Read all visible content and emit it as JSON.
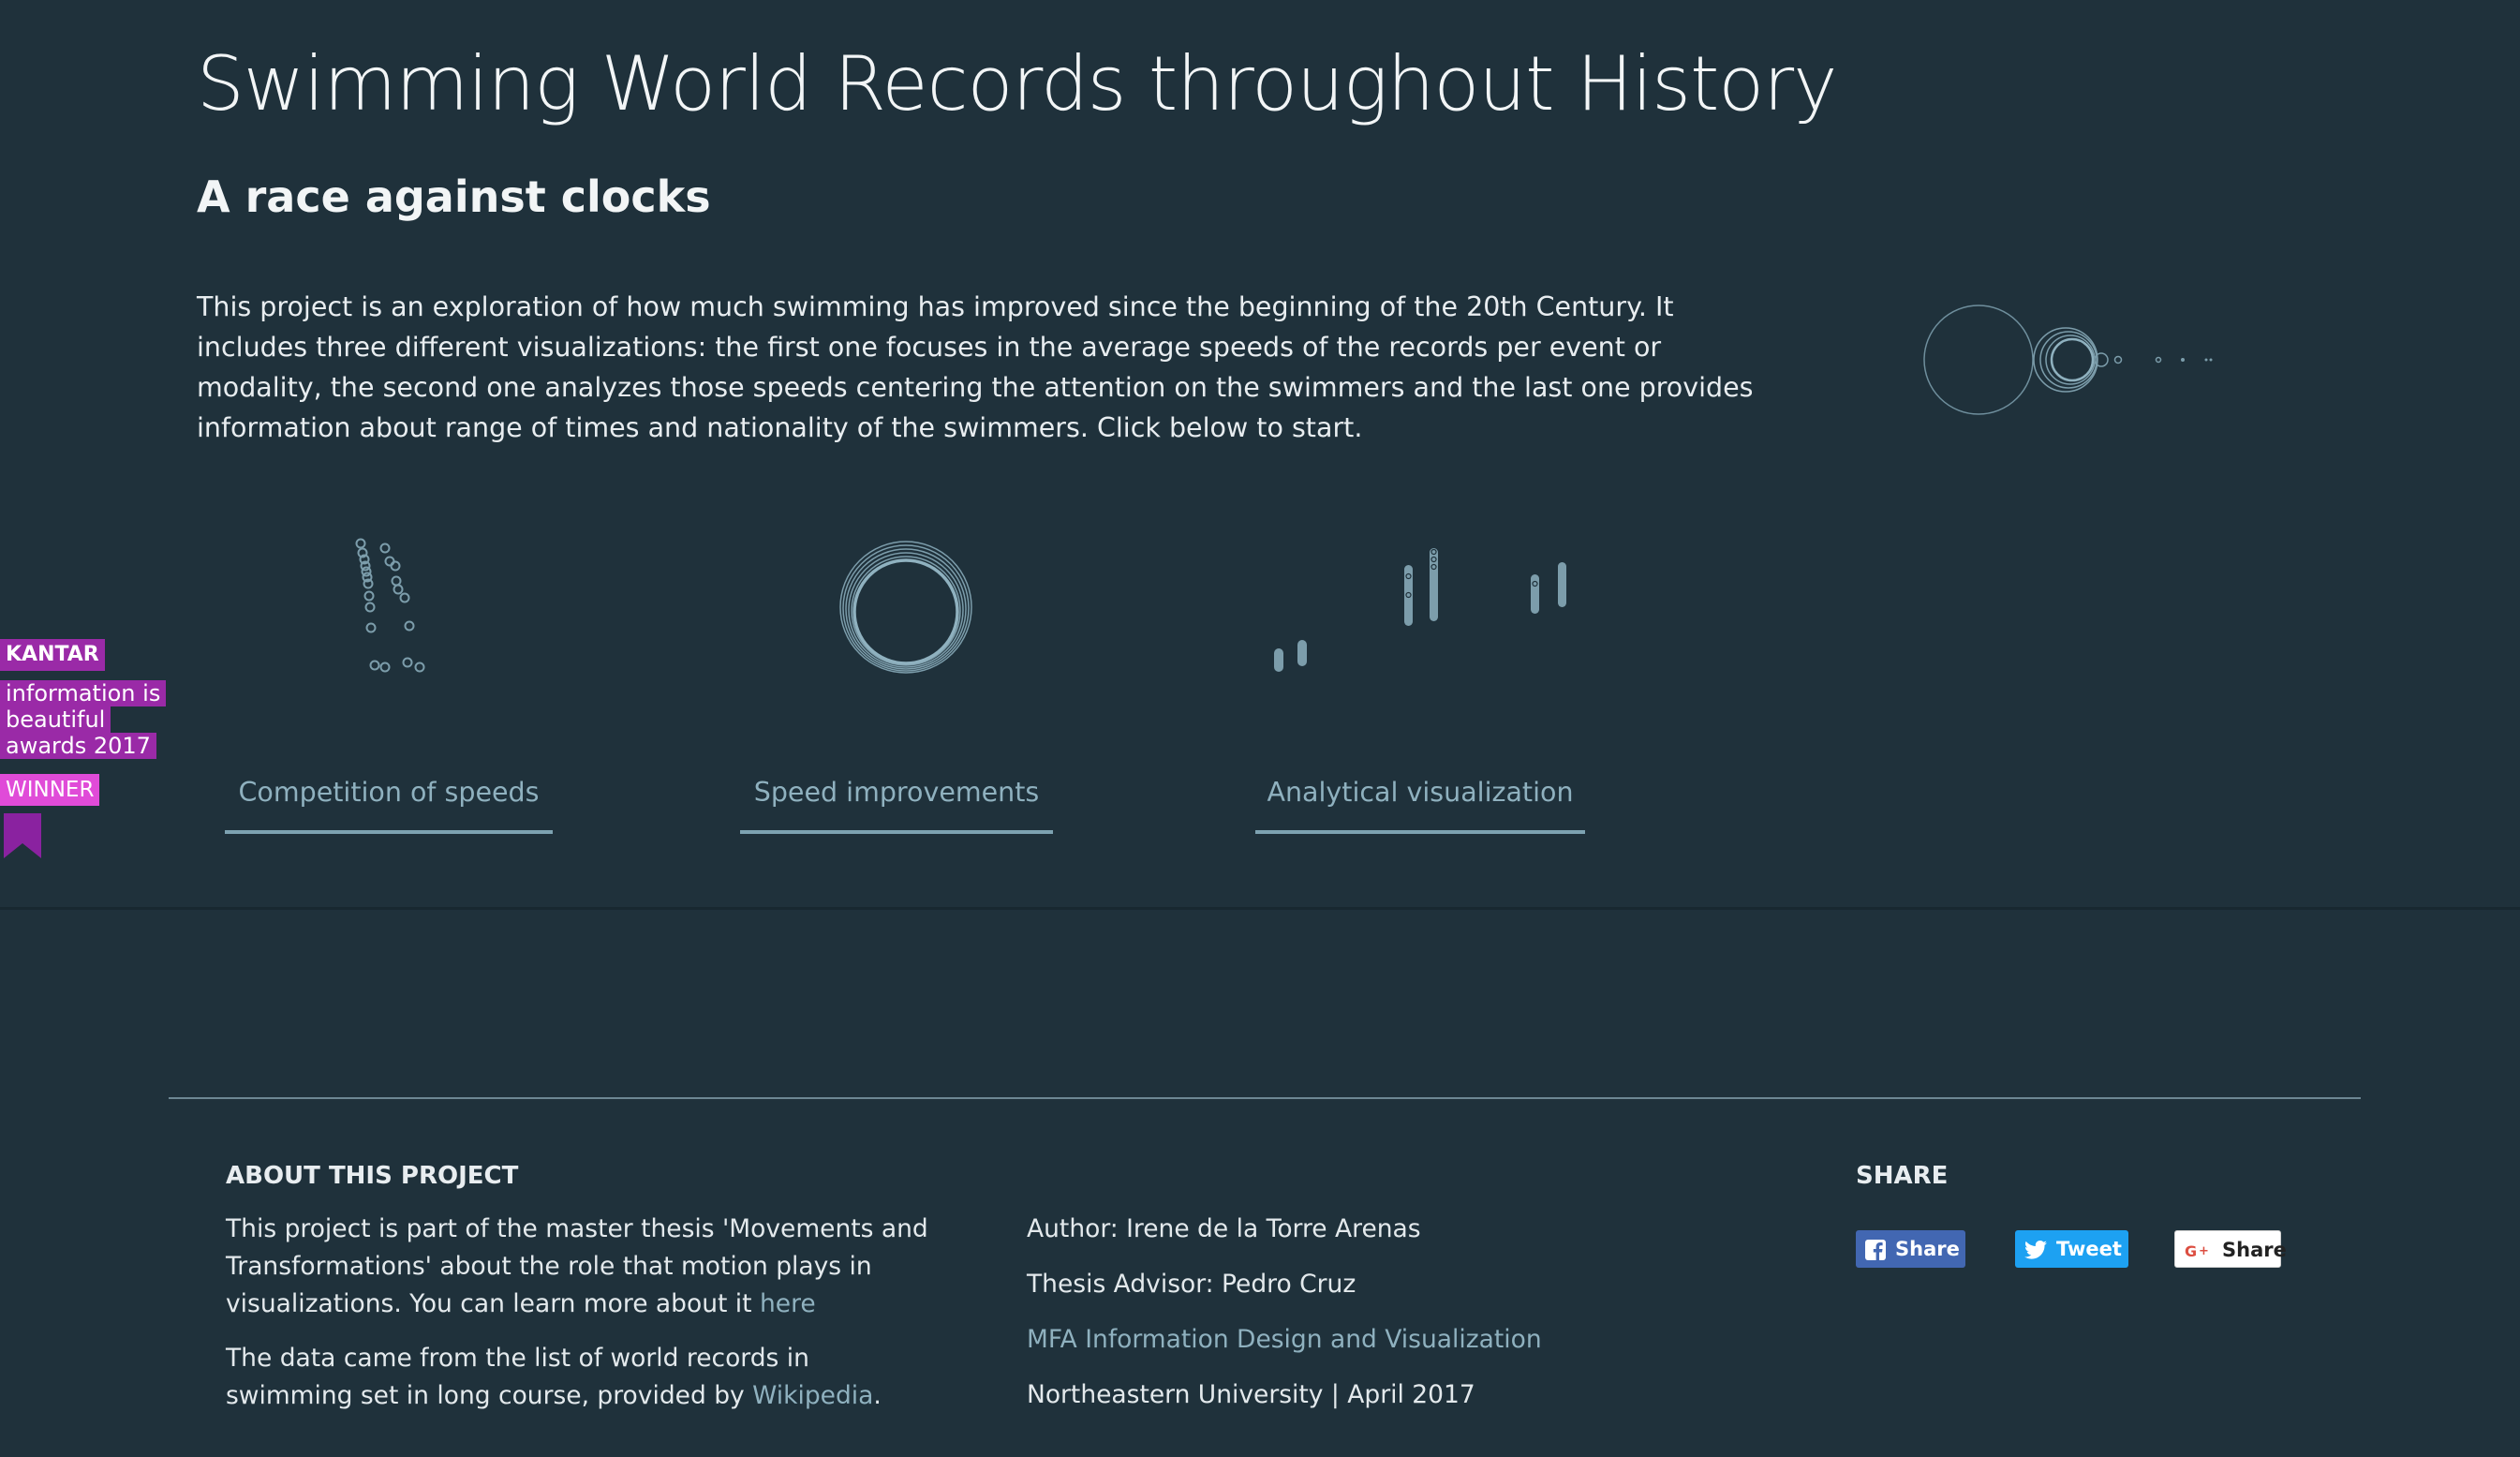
{
  "hero": {
    "title": "Swimming World Records throughout History",
    "subtitle": "A race against clocks",
    "intro": "This project is an exploration of how much swimming has improved since the beginning of the 20th Century. It includes three different visualizations: the first one focuses in the average speeds of the records per event or modality, the second one analyzes those speeds centering the attention on the swimmers and the last one provides information about range of times and nationality of the swimmers. Click below to start."
  },
  "visualizations": [
    {
      "label": "Competition of speeds",
      "icon": "scattered-circles-thumbnail"
    },
    {
      "label": "Speed improvements",
      "icon": "concentric-rings-thumbnail"
    },
    {
      "label": "Analytical visualization",
      "icon": "range-bars-thumbnail"
    }
  ],
  "award": {
    "sponsor": "KANTAR",
    "line1": "information is",
    "line2": "beautiful",
    "line3": "awards 2017",
    "status": "WINNER"
  },
  "footer": {
    "about": {
      "heading": "ABOUT THIS PROJECT",
      "para1_line1": "This project is part of the master thesis 'Movements and",
      "para1_line2": "Transformations' about the role that motion plays in",
      "para1_line3_text": "visualizations. You can learn more about it ",
      "para1_link": "here",
      "para2_line1": "The data came from the list of world records in",
      "para2_line2_text": "swimming set in long course, provided by ",
      "para2_link": "Wikipedia",
      "para2_end": "."
    },
    "credits": {
      "author": "Author: Irene de la Torre Arenas",
      "advisor": "Thesis Advisor: Pedro Cruz",
      "program": "MFA Information Design and Visualization",
      "university": "Northeastern University | April 2017"
    },
    "share": {
      "heading": "SHARE",
      "facebook_label": "Share",
      "twitter_label": "Tweet",
      "google_label": "Share"
    }
  },
  "colors": {
    "background": "#1f313b",
    "accent": "#8fb1bf",
    "ribbon": "#9a2aa7",
    "ribbon_highlight": "#e04bd8"
  }
}
